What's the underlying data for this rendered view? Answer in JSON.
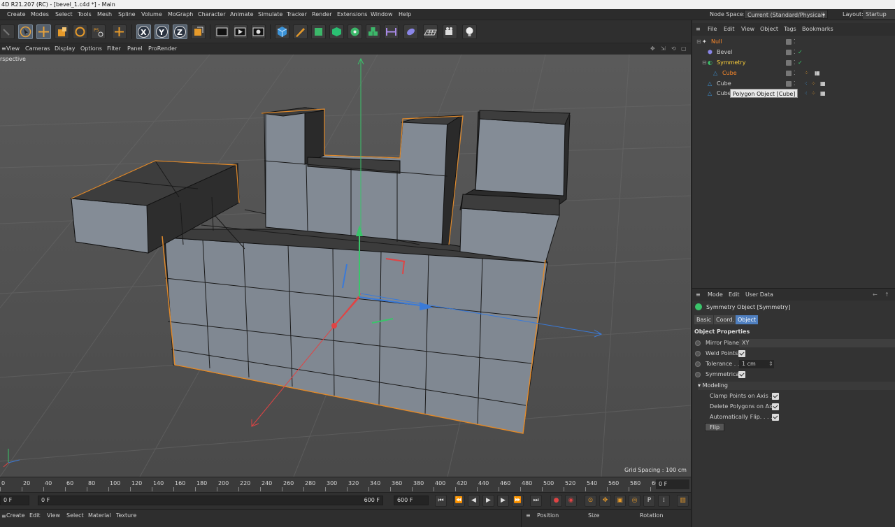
{
  "window": {
    "title": "4D R21.207 (RC) - [bevel_1.c4d *] - Main"
  },
  "menubar": {
    "items": [
      "Create",
      "Modes",
      "Select",
      "Tools",
      "Mesh",
      "Spline",
      "Volume",
      "MoGraph",
      "Character",
      "Animate",
      "Simulate",
      "Tracker",
      "Render",
      "Extensions",
      "Window",
      "Help"
    ],
    "node_space_label": "Node Space:",
    "node_space_value": "Current (Standard/Physical)",
    "layout_label": "Layout:",
    "layout_value": "Startup"
  },
  "toolbar": {
    "icons": [
      "undo-icon",
      "select-icon",
      "move-icon",
      "scale-icon",
      "rotate-icon",
      "psr-icon",
      "add-icon",
      "x-axis-icon",
      "y-axis-icon",
      "z-axis-icon",
      "coord-system-icon",
      "render-view-icon",
      "render-picture-viewer-icon",
      "render-settings-icon",
      "cube-icon",
      "pen-icon",
      "subdivision-icon",
      "cloner-icon",
      "deformer-icon",
      "mograph-icon",
      "symmetry-icon",
      "field-icon",
      "floor-icon",
      "camera-icon",
      "light-icon"
    ],
    "axis_labels": {
      "x": "X",
      "y": "Y",
      "z": "Z"
    }
  },
  "viewport": {
    "menu": [
      "View",
      "Cameras",
      "Display",
      "Options",
      "Filter",
      "Panel",
      "ProRender"
    ],
    "label": "rspective",
    "grid_spacing": "Grid Spacing : 100 cm"
  },
  "timeline": {
    "ticks": [
      "0",
      "20",
      "40",
      "60",
      "80",
      "100",
      "120",
      "140",
      "160",
      "180",
      "200",
      "220",
      "240",
      "260",
      "280",
      "300",
      "320",
      "340",
      "360",
      "380",
      "400",
      "420",
      "440",
      "460",
      "480",
      "500",
      "520",
      "540",
      "560",
      "580",
      "60"
    ],
    "current_frame": "0 F"
  },
  "transport": {
    "start": "0 F",
    "min": "0 F",
    "max_inner": "600 F",
    "max": "600 F",
    "buttons": [
      "go-start",
      "prev-key",
      "prev-frame",
      "play",
      "next-frame",
      "next-key",
      "go-end"
    ]
  },
  "material_bar": {
    "items": [
      "Create",
      "Edit",
      "View",
      "Select",
      "Material",
      "Texture"
    ]
  },
  "coord_bar": {
    "items": [
      "Position",
      "Size",
      "Rotation"
    ]
  },
  "object_manager": {
    "menu": [
      "File",
      "Edit",
      "View",
      "Object",
      "Tags",
      "Bookmarks"
    ],
    "objects": [
      {
        "name": "Null",
        "color": "#ff8a2a"
      },
      {
        "name": "Bevel",
        "color": "#cfcfcf"
      },
      {
        "name": "Symmetry",
        "color": "#ffd23a"
      },
      {
        "name": "Cube",
        "color": "#ff8a2a"
      },
      {
        "name": "Cube",
        "color": "#cfcfcf"
      },
      {
        "name": "Cube",
        "color": "#cfcfcf"
      }
    ],
    "tooltip": "Polygon Object [Cube]"
  },
  "attributes": {
    "menu": [
      "Mode",
      "Edit",
      "User Data"
    ],
    "object_title": "Symmetry Object [Symmetry]",
    "tabs": [
      "Basic",
      "Coord.",
      "Object"
    ],
    "active_tab": "Object",
    "section": "Object Properties",
    "mirror_plane_label": "Mirror Plane",
    "mirror_plane_value": "XY",
    "weld_points_label": "Weld Points",
    "tolerance_label": "Tolerance . .",
    "tolerance_value": "1 cm",
    "symmetrical_label": "Symmetrical",
    "modeling_header": "Modeling",
    "clamp_label": "Clamp Points on Axis .",
    "delete_label": "Delete Polygons on Axis",
    "auto_flip_label": "Automatically Flip. . . .",
    "flip_button": "Flip"
  },
  "colors": {
    "accent": "#4f7fbf",
    "selected_orange": "#ff8a2a",
    "symmetry_yellow": "#ffd23a"
  }
}
